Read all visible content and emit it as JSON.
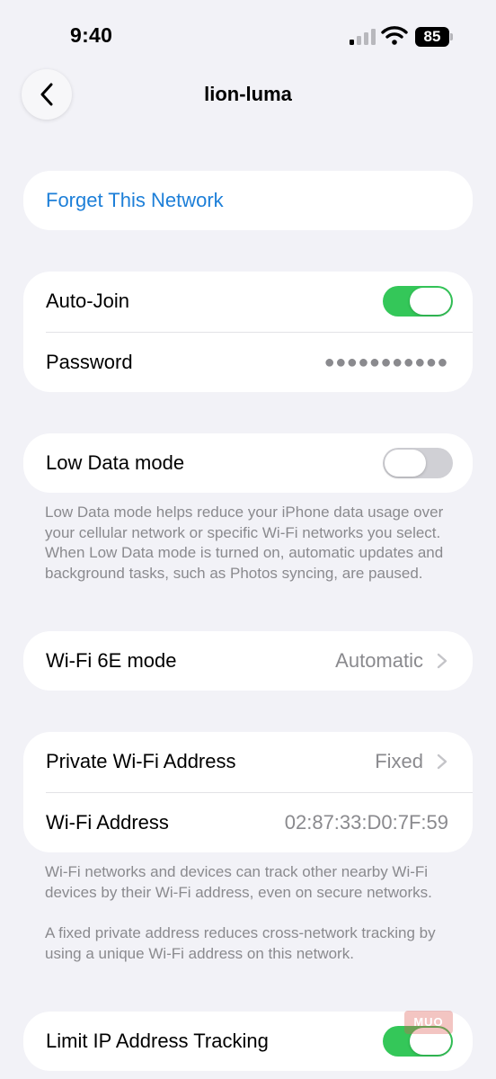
{
  "status_bar": {
    "time": "9:40",
    "battery_level": "85",
    "icons": [
      "signal-icon",
      "wifi-icon",
      "battery-icon"
    ]
  },
  "nav": {
    "title": "lion-luma",
    "back_icon": "chevron-left-icon"
  },
  "forget": {
    "label": "Forget This Network"
  },
  "join": {
    "auto_join_label": "Auto-Join",
    "auto_join_on": true,
    "password_label": "Password",
    "password_mask": "●●●●●●●●●●●"
  },
  "low_data": {
    "label": "Low Data mode",
    "on": false,
    "footnote": "Low Data mode helps reduce your iPhone data usage over your cellular network or specific Wi-Fi networks you select. When Low Data mode is turned on, automatic updates and background tasks, such as Photos syncing, are paused."
  },
  "wifi6e": {
    "label": "Wi-Fi 6E mode",
    "value": "Automatic"
  },
  "private_address": {
    "label": "Private Wi-Fi Address",
    "value": "Fixed",
    "address_label": "Wi-Fi Address",
    "address_value": "02:87:33:D0:7F:59",
    "footnote_1": "Wi-Fi networks and devices can track other nearby Wi-Fi devices by their Wi-Fi address, even on secure networks.",
    "footnote_2": "A fixed private address reduces cross-network tracking by using a unique Wi-Fi address on this network."
  },
  "ip_tracking": {
    "label": "Limit IP Address Tracking",
    "on": true
  },
  "watermark": {
    "text": "MUO"
  },
  "colors": {
    "background": "#f2f2f7",
    "accent_link": "#1d7fd8",
    "toggle_on": "#34c759",
    "toggle_off": "#d0d0d5",
    "secondary_text": "#8a8a8e"
  }
}
